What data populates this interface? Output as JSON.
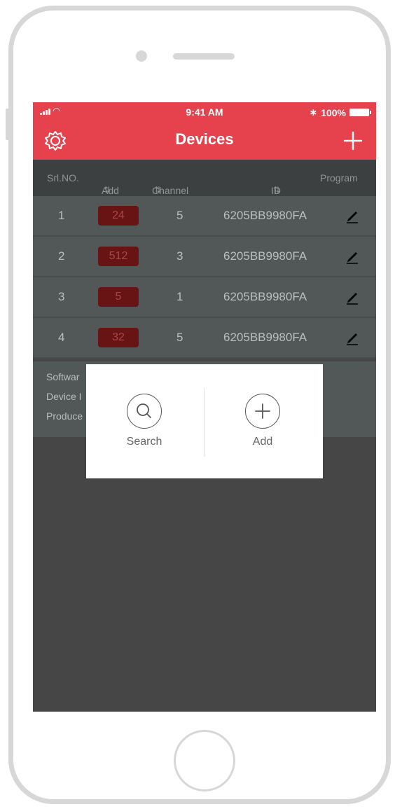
{
  "status": {
    "time": "9:41 AM",
    "battery": "100%"
  },
  "header": {
    "title": "Devices"
  },
  "table": {
    "columns": [
      "Srl.NO.",
      "Add",
      "Channel",
      "ID",
      "Program"
    ],
    "rows": [
      {
        "srl": "1",
        "add": "24",
        "channel": "5",
        "id": "6205BB9980FA"
      },
      {
        "srl": "2",
        "add": "512",
        "channel": "3",
        "id": "6205BB9980FA"
      },
      {
        "srl": "3",
        "add": "5",
        "channel": "1",
        "id": "6205BB9980FA"
      },
      {
        "srl": "4",
        "add": "32",
        "channel": "5",
        "id": "6205BB9980FA"
      }
    ]
  },
  "info": {
    "lines": [
      "Softwar",
      "Device I",
      "Produce"
    ]
  },
  "popup": {
    "search_label": "Search",
    "add_label": "Add"
  },
  "colors": {
    "accent": "#e5424d",
    "badge_bg": "#681414",
    "overlay": "#464646"
  },
  "icons": {
    "settings": "gear-icon",
    "add": "plus-icon",
    "search": "search-icon",
    "edit": "edit-icon",
    "sort": "sort-icon"
  }
}
